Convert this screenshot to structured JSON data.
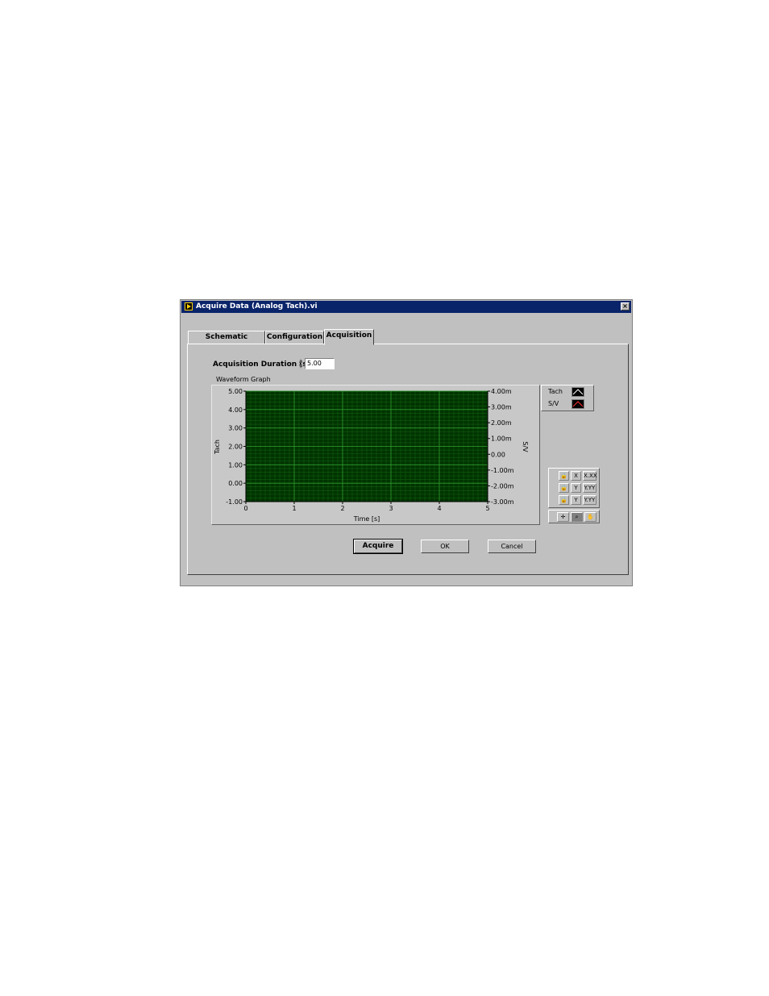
{
  "window": {
    "title": "Acquire Data (Analog Tach).vi",
    "close_glyph": "×"
  },
  "tabs": [
    {
      "label": "Schematic Diagram",
      "active": false
    },
    {
      "label": "Configuration",
      "active": false
    },
    {
      "label": "Acquisition",
      "active": true
    }
  ],
  "acquisition": {
    "duration_label": "Acquisition Duration [s]",
    "duration_value": "5.00"
  },
  "graph": {
    "label": "Waveform Graph",
    "plot_background": "#003300",
    "grid_color": "#2e9a2e",
    "minor_grid_color": "#125c12"
  },
  "legend": {
    "items": [
      {
        "name": "Tach",
        "color": "#ffffff"
      },
      {
        "name": "S/V",
        "color": "#ff3030"
      }
    ]
  },
  "scale_palette": {
    "x_format": "X.XX",
    "y_format": "Y.YY",
    "x_autoscale": "X",
    "y_autoscale": "Y"
  },
  "buttons": {
    "acquire": "Acquire",
    "ok": "OK",
    "cancel": "Cancel"
  },
  "chart_data": {
    "type": "line",
    "title": "Waveform Graph",
    "xlabel": "Time [s]",
    "ylabel": "Tach",
    "y2label": "S/V",
    "xlim": [
      0,
      5
    ],
    "ylim": [
      -1,
      5
    ],
    "y2lim": [
      -0.003,
      0.004
    ],
    "x_ticks": [
      "0",
      "1",
      "2",
      "3",
      "4",
      "5"
    ],
    "y_ticks": [
      "5.00",
      "4.00",
      "3.00",
      "2.00",
      "1.00",
      "0.00",
      "-1.00"
    ],
    "y2_ticks": [
      "4.00m",
      "3.00m",
      "2.00m",
      "1.00m",
      "0.00",
      "-1.00m",
      "-2.00m",
      "-3.00m"
    ],
    "grid": true,
    "series": [
      {
        "name": "Tach",
        "values": []
      },
      {
        "name": "S/V",
        "values": []
      }
    ]
  }
}
